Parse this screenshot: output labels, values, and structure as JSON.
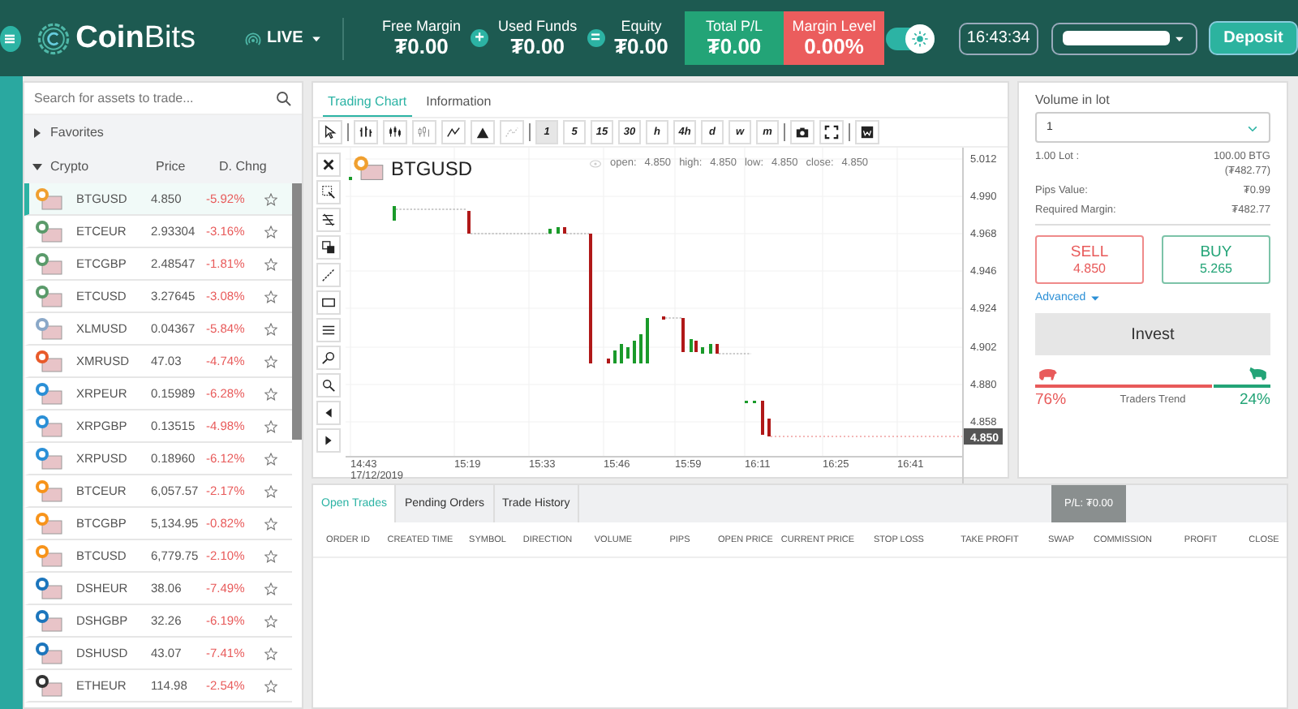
{
  "header": {
    "logo": "**Coin**Bits",
    "mode": "LIVE",
    "stats": [
      {
        "label": "Free Margin",
        "value": "₮0.00"
      },
      {
        "label": "Used Funds",
        "value": "₮0.00",
        "operator": "+"
      },
      {
        "label": "Equity",
        "value": "₮0.00",
        "operator": "="
      }
    ],
    "total_pl": {
      "label": "Total P/L",
      "value": "₮0.00"
    },
    "margin_level": {
      "label": "Margin Level",
      "value": "0.00%"
    },
    "theme_toggle": {
      "on": true
    },
    "clock": "16:43:34",
    "deposit": "Deposit"
  },
  "sidebar": {
    "search": {
      "placeholder": "Search for assets to trade..."
    },
    "groups": [
      {
        "label": "Favorites",
        "expanded": false
      },
      {
        "label": "Crypto",
        "expanded": true
      }
    ],
    "columns": [
      "Price",
      "D. Chng"
    ],
    "assets": [
      {
        "symbol": "BTGUSD",
        "price": "4.850",
        "change": "-5.92%",
        "selected": true,
        "favorite": false,
        "color": "#f0a030"
      },
      {
        "symbol": "ETCEUR",
        "price": "2.93304",
        "change": "-3.16%",
        "selected": false,
        "favorite": false,
        "color": "#5a9a6a"
      },
      {
        "symbol": "ETCGBP",
        "price": "2.48547",
        "change": "-1.81%",
        "selected": false,
        "favorite": false,
        "color": "#5a9a6a"
      },
      {
        "symbol": "ETCUSD",
        "price": "3.27645",
        "change": "-3.08%",
        "selected": false,
        "favorite": false,
        "color": "#5a9a6a"
      },
      {
        "symbol": "XLMUSD",
        "price": "0.04367",
        "change": "-5.84%",
        "selected": false,
        "favorite": false,
        "color": "#8aa8c8"
      },
      {
        "symbol": "XMRUSD",
        "price": "47.03",
        "change": "-4.74%",
        "selected": false,
        "favorite": false,
        "color": "#e85a2a"
      },
      {
        "symbol": "XRPEUR",
        "price": "0.15989",
        "change": "-6.28%",
        "selected": false,
        "favorite": false,
        "color": "#2a8fd6"
      },
      {
        "symbol": "XRPGBP",
        "price": "0.13515",
        "change": "-4.98%",
        "selected": false,
        "favorite": false,
        "color": "#2a8fd6"
      },
      {
        "symbol": "XRPUSD",
        "price": "0.18960",
        "change": "-6.12%",
        "selected": false,
        "favorite": false,
        "color": "#2a8fd6"
      },
      {
        "symbol": "BTCEUR",
        "price": "6,057.57",
        "change": "-2.17%",
        "selected": false,
        "favorite": false,
        "color": "#f7931a"
      },
      {
        "symbol": "BTCGBP",
        "price": "5,134.95",
        "change": "-0.82%",
        "selected": false,
        "favorite": false,
        "color": "#f7931a"
      },
      {
        "symbol": "BTCUSD",
        "price": "6,779.75",
        "change": "-2.10%",
        "selected": false,
        "favorite": false,
        "color": "#f7931a"
      },
      {
        "symbol": "DSHEUR",
        "price": "38.06",
        "change": "-7.49%",
        "selected": false,
        "favorite": false,
        "color": "#1c75bc"
      },
      {
        "symbol": "DSHGBP",
        "price": "32.26",
        "change": "-6.19%",
        "selected": false,
        "favorite": false,
        "color": "#1c75bc"
      },
      {
        "symbol": "DSHUSD",
        "price": "43.07",
        "change": "-7.41%",
        "selected": false,
        "favorite": false,
        "color": "#1c75bc"
      },
      {
        "symbol": "ETHEUR",
        "price": "114.98",
        "change": "-2.54%",
        "selected": false,
        "favorite": false,
        "color": "#333333"
      }
    ]
  },
  "chart": {
    "tabs": [
      {
        "label": "Trading Chart",
        "selected": true
      },
      {
        "label": "Information",
        "selected": false
      }
    ],
    "timeframes": [
      {
        "label": "1",
        "selected": true
      },
      {
        "label": "5",
        "selected": false
      },
      {
        "label": "15",
        "selected": false
      },
      {
        "label": "30",
        "selected": false
      },
      {
        "label": "h",
        "selected": false
      },
      {
        "label": "4h",
        "selected": false
      },
      {
        "label": "d",
        "selected": false
      },
      {
        "label": "w",
        "selected": false
      },
      {
        "label": "m",
        "selected": false
      }
    ],
    "symbol": "BTGUSD",
    "ohlc": [
      {
        "label": "open:",
        "value": "4.850"
      },
      {
        "label": "high:",
        "value": "4.850"
      },
      {
        "label": "low:",
        "value": "4.850"
      },
      {
        "label": "close:",
        "value": "4.850"
      }
    ],
    "y_labels": [
      "5.012",
      "4.990",
      "4.968",
      "4.946",
      "4.924",
      "4.902",
      "4.880",
      "4.858"
    ],
    "current_price": "4.850",
    "x_labels": [
      {
        "time": "14:43",
        "date": "17/12/2019"
      },
      {
        "time": "15:19"
      },
      {
        "time": "15:33"
      },
      {
        "time": "15:46"
      },
      {
        "time": "15:59"
      },
      {
        "time": "16:11"
      },
      {
        "time": "16:25"
      },
      {
        "time": "16:41"
      }
    ]
  },
  "order": {
    "volume_label": "Volume in lot",
    "volume": "1",
    "details": [
      {
        "label": "1.00 Lot :",
        "value": "100.00 BTG",
        "note": "(₮482.77)"
      },
      {
        "label": "Pips Value:",
        "value": "₮0.99"
      },
      {
        "label": "Required Margin:",
        "value": "₮482.77"
      }
    ],
    "sell": {
      "label": "SELL",
      "price": "4.850"
    },
    "buy": {
      "label": "BUY",
      "price": "5.265"
    },
    "advanced": "Advanced",
    "invest": "Invest",
    "trend": {
      "level": 0.76,
      "bear": "76%",
      "label": "Traders Trend",
      "bull": "24%"
    }
  },
  "trades": {
    "tabs": [
      {
        "label": "Open Trades",
        "selected": true
      },
      {
        "label": "Pending Orders",
        "selected": false
      },
      {
        "label": "Trade History",
        "selected": false
      }
    ],
    "pl": "P/L: ₮0.00",
    "columns": [
      "ORDER ID",
      "CREATED TIME",
      "SYMBOL",
      "DIRECTION",
      "VOLUME",
      "PIPS",
      "OPEN PRICE",
      "CURRENT PRICE",
      "STOP LOSS",
      "TAKE PROFIT",
      "SWAP",
      "COMMISSION",
      "PROFIT",
      "CLOSE"
    ]
  }
}
